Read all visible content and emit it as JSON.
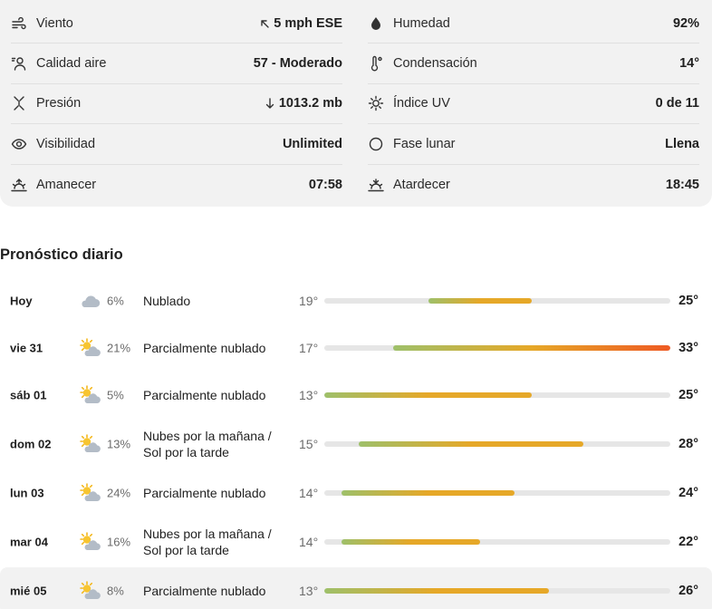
{
  "details": {
    "left": [
      {
        "icon": "wind-icon",
        "label": "Viento",
        "value": "5 mph ESE",
        "value_icon": "arrow-up-left-icon"
      },
      {
        "icon": "person-air-icon",
        "label": "Calidad aire",
        "value": "57 - Moderado"
      },
      {
        "icon": "pressure-icon",
        "label": "Presión",
        "value": "1013.2 mb",
        "value_icon": "arrow-down-icon"
      },
      {
        "icon": "eye-icon",
        "label": "Visibilidad",
        "value": "Unlimited"
      },
      {
        "icon": "sunrise-icon",
        "label": "Amanecer",
        "value": "07:58"
      }
    ],
    "right": [
      {
        "icon": "drop-icon",
        "label": "Humedad",
        "value": "92%"
      },
      {
        "icon": "dewpoint-icon",
        "label": "Condensación",
        "value": "14°"
      },
      {
        "icon": "sun-outline-icon",
        "label": "Índice UV",
        "value": "0 de 11"
      },
      {
        "icon": "moon-full-icon",
        "label": "Fase lunar",
        "value": "Llena"
      },
      {
        "icon": "sunset-icon",
        "label": "Atardecer",
        "value": "18:45"
      }
    ]
  },
  "forecast_title": "Pronóstico diario",
  "forecast": [
    {
      "day": "Hoy",
      "icon": "cloud-icon",
      "pop": "6%",
      "cond": "Nublado",
      "low": "19°",
      "high": "25°",
      "low_val": 19,
      "high_val": 25
    },
    {
      "day": "vie 31",
      "icon": "partly-cloudy-icon",
      "pop": "21%",
      "cond": "Parcialmente nublado",
      "low": "17°",
      "high": "33°",
      "low_val": 17,
      "high_val": 33
    },
    {
      "day": "sáb 01",
      "icon": "partly-cloudy-icon",
      "pop": "5%",
      "cond": "Parcialmente nublado",
      "low": "13°",
      "high": "25°",
      "low_val": 13,
      "high_val": 25
    },
    {
      "day": "dom 02",
      "icon": "partly-cloudy-icon",
      "pop": "13%",
      "cond": "Nubes por la mañana / Sol por la tarde",
      "low": "15°",
      "high": "28°",
      "low_val": 15,
      "high_val": 28
    },
    {
      "day": "lun 03",
      "icon": "partly-cloudy-icon",
      "pop": "24%",
      "cond": "Parcialmente nublado",
      "low": "14°",
      "high": "24°",
      "low_val": 14,
      "high_val": 24
    },
    {
      "day": "mar 04",
      "icon": "partly-cloudy-icon",
      "pop": "16%",
      "cond": "Nubes por la mañana / Sol por la tarde",
      "low": "14°",
      "high": "22°",
      "low_val": 14,
      "high_val": 22
    },
    {
      "day": "mié 05",
      "icon": "partly-cloudy-icon",
      "pop": "8%",
      "cond": "Parcialmente nublado",
      "low": "13°",
      "high": "26°",
      "low_val": 13,
      "high_val": 26,
      "highlight": true
    }
  ],
  "temp_range": [
    13,
    33
  ],
  "colors": {
    "cool": "#9ec06a",
    "mid": "#e6a828",
    "hot": "#ee5a24",
    "track": "#e6e6e6"
  }
}
